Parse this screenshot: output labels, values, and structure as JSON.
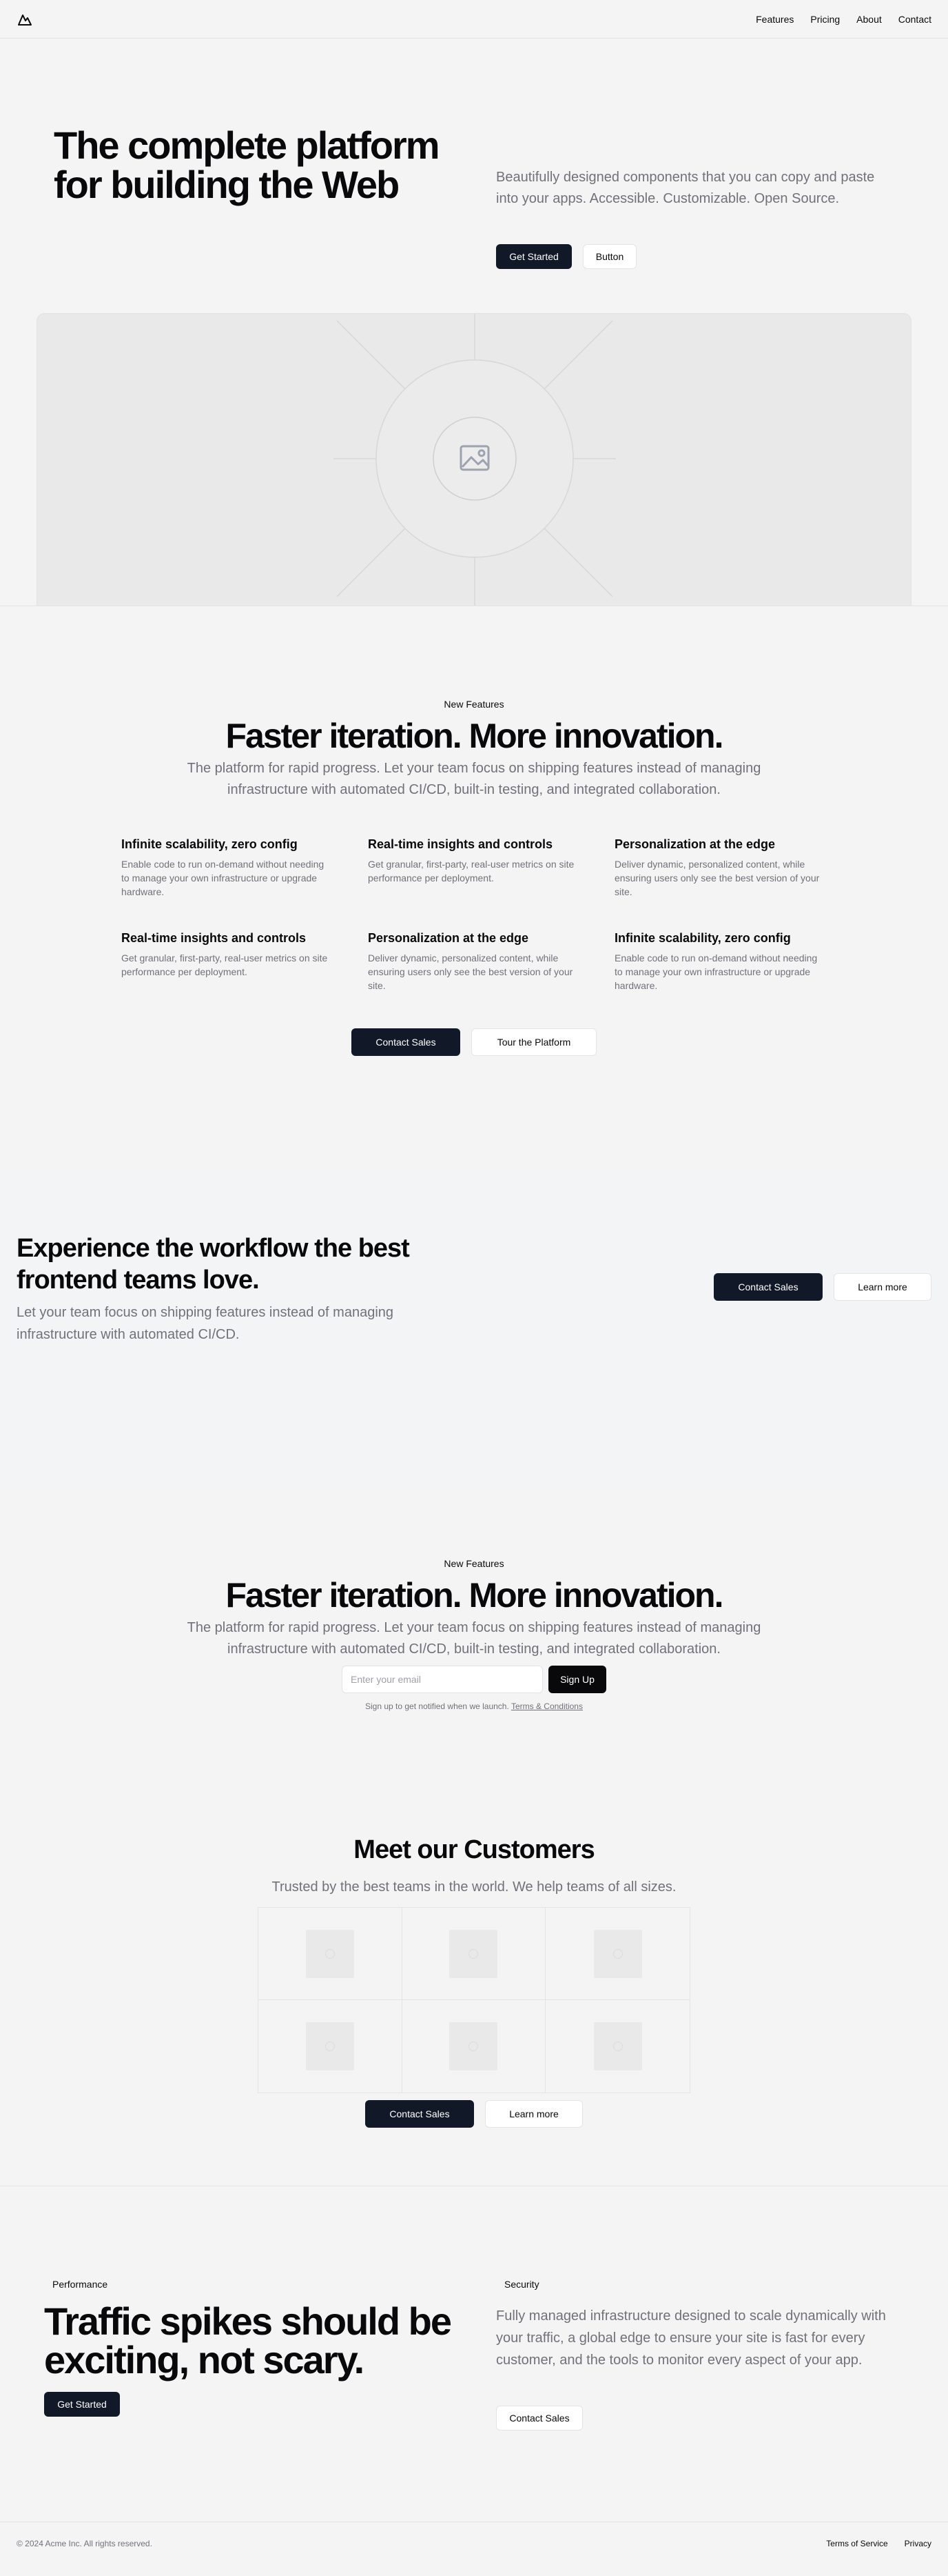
{
  "header": {
    "logo": "mountain-icon",
    "nav": [
      "Features",
      "Pricing",
      "About",
      "Contact"
    ]
  },
  "hero": {
    "title": "The complete platform for building the Web",
    "description": "Beautifully designed components that you can copy and paste into your apps. Accessible. Customizable. Open Source.",
    "primary_button": "Get Started",
    "secondary_button": "Button",
    "image": "image-placeholder-icon"
  },
  "features": {
    "eyebrow": "New Features",
    "title": "Faster iteration. More innovation.",
    "subtitle": "The platform for rapid progress. Let your team focus on shipping features instead of managing infrastructure with automated CI/CD, built-in testing, and integrated collaboration.",
    "items": [
      {
        "title": "Infinite scalability, zero config",
        "body": "Enable code to run on-demand without needing to manage your own infrastructure or upgrade hardware."
      },
      {
        "title": "Real-time insights and controls",
        "body": "Get granular, first-party, real-user metrics on site performance per deployment."
      },
      {
        "title": "Personalization at the edge",
        "body": "Deliver dynamic, personalized content, while ensuring users only see the best version of your site."
      },
      {
        "title": "Real-time insights and controls",
        "body": "Get granular, first-party, real-user metrics on site performance per deployment."
      },
      {
        "title": "Personalization at the edge",
        "body": "Deliver dynamic, personalized content, while ensuring users only see the best version of your site."
      },
      {
        "title": "Infinite scalability, zero config",
        "body": "Enable code to run on-demand without needing to manage your own infrastructure or upgrade hardware."
      }
    ],
    "primary_button": "Contact Sales",
    "secondary_button": "Tour the Platform"
  },
  "workflow": {
    "title": "Experience the workflow the best frontend teams love.",
    "description": "Let your team focus on shipping features instead of managing infrastructure with automated CI/CD.",
    "primary_button": "Contact Sales",
    "secondary_button": "Learn more"
  },
  "signup": {
    "eyebrow": "New Features",
    "title": "Faster iteration. More innovation.",
    "subtitle": "The platform for rapid progress. Let your team focus on shipping features instead of managing infrastructure with automated CI/CD, built-in testing, and integrated collaboration.",
    "email_placeholder": "Enter your email",
    "button": "Sign Up",
    "fine_print": "Sign up to get notified when we launch.",
    "terms_link": "Terms & Conditions"
  },
  "customers": {
    "title": "Meet our Customers",
    "subtitle": "Trusted by the best teams in the world. We help teams of all sizes.",
    "logo_count": 6,
    "primary_button": "Contact Sales",
    "secondary_button": "Learn more"
  },
  "performance": {
    "badge_left": "Performance",
    "badge_right": "Security",
    "title": "Traffic spikes should be exciting, not scary.",
    "description": "Fully managed infrastructure designed to scale dynamically with your traffic, a global edge to ensure your site is fast for every customer, and the tools to monitor every aspect of your app.",
    "primary_button": "Get Started",
    "secondary_button": "Contact Sales"
  },
  "footer": {
    "copyright": "© 2024 Acme Inc. All rights reserved.",
    "links": [
      "Terms of Service",
      "Privacy"
    ]
  }
}
